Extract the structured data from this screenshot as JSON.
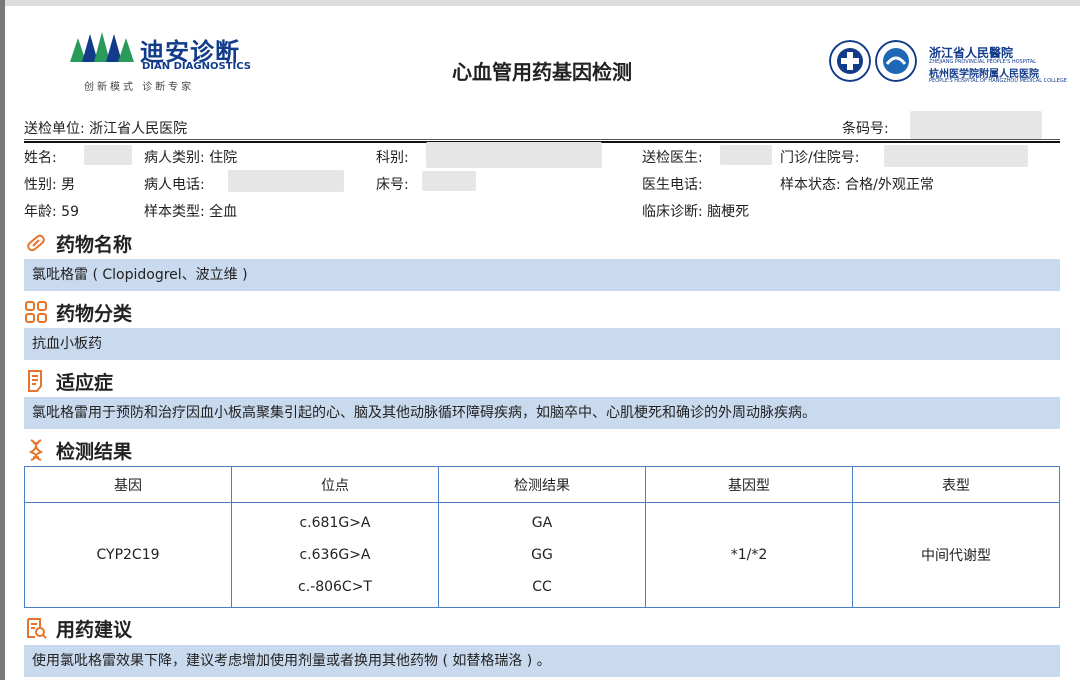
{
  "header": {
    "logo_cn": "迪安诊断",
    "logo_en": "DIAN DIAGNOSTICS",
    "slogan": "创新模式 诊断专家",
    "title": "心血管用药基因检测",
    "hospital_cn": "浙江省人民醫院",
    "hospital_en": "ZHEJIANG PROVINCIAL PEOPLE'S HOSPITAL",
    "hospital_sub_cn": "杭州医学院附属人民医院",
    "hospital_sub_en": "PEOPLE'S HOSPITAL OF HANGZHOU MEDICAL COLLEGE"
  },
  "info": {
    "unit": "送检单位: 浙江省人民医院",
    "barcode": "条码号:",
    "name": "姓名:",
    "patient_type": "病人类别: 住院",
    "department": "科别:",
    "doctor": "送检医生:",
    "visit_no": "门诊/住院号:",
    "gender": "性别: 男",
    "patient_phone": "病人电话:",
    "bed": "床号:",
    "doctor_phone": "医生电话:",
    "sample_status": "样本状态: 合格/外观正常",
    "age": "年龄: 59",
    "sample_type": "样本类型: 全血",
    "diagnosis": "临床诊断: 脑梗死"
  },
  "sections": {
    "drug_name_title": "药物名称",
    "drug_name": "氯吡格雷 ( Clopidogrel、波立维 )",
    "drug_class_title": "药物分类",
    "drug_class": "抗血小板药",
    "indication_title": "适应症",
    "indication": "氯吡格雷用于预防和治疗因血小板高聚集引起的心、脑及其他动脉循环障碍疾病，如脑卒中、心肌梗死和确诊的外周动脉疾病。",
    "result_title": "检测结果",
    "advice_title": "用药建议",
    "advice": "使用氯吡格雷效果下降，建议考虑增加使用剂量或者换用其他药物 ( 如替格瑞洛 ) 。"
  },
  "table": {
    "headers": [
      "基因",
      "位点",
      "检测结果",
      "基因型",
      "表型"
    ],
    "gene": "CYP2C19",
    "loci": [
      "c.681G>A",
      "c.636G>A",
      "c.-806C>T"
    ],
    "results": [
      "GA",
      "GG",
      "CC"
    ],
    "genotype": "*1/*2",
    "phenotype": "中间代谢型"
  },
  "colors": {
    "band": "#c9d9ee",
    "table_border": "#4a7fc4",
    "icon_orange": "#e8742a",
    "brand_blue": "#123b8a",
    "brand_green": "#2a9a5a"
  },
  "icons": [
    "pill-icon",
    "grid-icon",
    "document-icon",
    "dna-icon",
    "report-search-icon"
  ]
}
